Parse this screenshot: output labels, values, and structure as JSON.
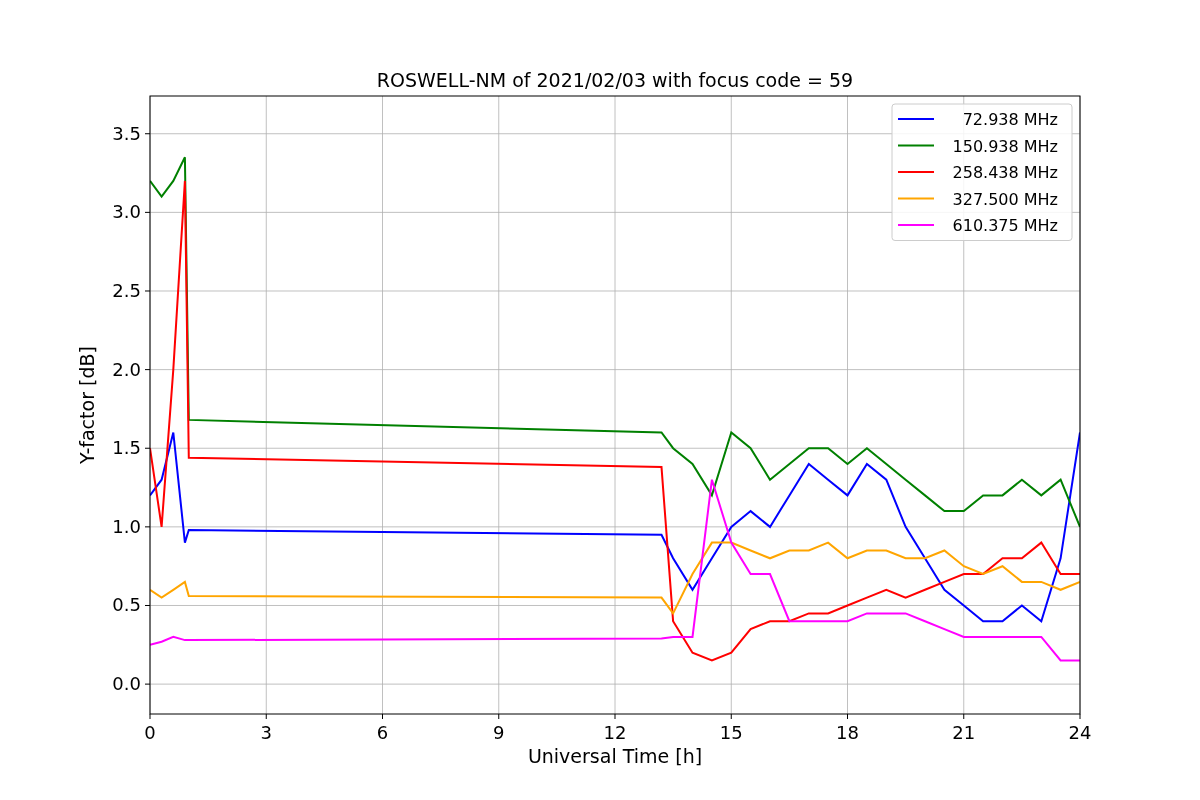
{
  "chart_data": {
    "type": "line",
    "title": "ROSWELL-NM of 2021/02/03 with focus code = 59",
    "xlabel": "Universal Time [h]",
    "ylabel": "Y-factor [dB]",
    "x": [
      0,
      0.3,
      0.6,
      0.9,
      1.0,
      13.2,
      13.5,
      14,
      14.5,
      15,
      15.5,
      16,
      16.5,
      17,
      17.5,
      18,
      18.5,
      19,
      19.5,
      20,
      20.5,
      21,
      21.5,
      22,
      22.5,
      23,
      23.5,
      24
    ],
    "series": [
      {
        "name": "72.938 MHz",
        "color": "#0000ff",
        "values": [
          1.2,
          1.3,
          1.6,
          0.9,
          0.98,
          0.95,
          0.8,
          0.6,
          0.8,
          1.0,
          1.1,
          1.0,
          1.2,
          1.4,
          1.3,
          1.2,
          1.4,
          1.3,
          1.0,
          0.8,
          0.6,
          0.5,
          0.4,
          0.4,
          0.5,
          0.4,
          0.8,
          1.6
        ]
      },
      {
        "name": "150.938 MHz",
        "color": "#008000",
        "values": [
          3.2,
          3.1,
          3.2,
          3.35,
          1.68,
          1.6,
          1.5,
          1.4,
          1.2,
          1.6,
          1.5,
          1.3,
          1.4,
          1.5,
          1.5,
          1.4,
          1.5,
          1.4,
          1.3,
          1.2,
          1.1,
          1.1,
          1.2,
          1.2,
          1.3,
          1.2,
          1.3,
          1.0
        ]
      },
      {
        "name": "258.438 MHz",
        "color": "#ff0000",
        "values": [
          1.5,
          1.0,
          2.0,
          3.2,
          1.44,
          1.38,
          0.4,
          0.2,
          0.15,
          0.2,
          0.35,
          0.4,
          0.4,
          0.45,
          0.45,
          0.5,
          0.55,
          0.6,
          0.55,
          0.6,
          0.65,
          0.7,
          0.7,
          0.8,
          0.8,
          0.9,
          0.7,
          0.7
        ]
      },
      {
        "name": "327.500 MHz",
        "color": "#ffa500",
        "values": [
          0.6,
          0.55,
          0.6,
          0.65,
          0.56,
          0.55,
          0.45,
          0.7,
          0.9,
          0.9,
          0.85,
          0.8,
          0.85,
          0.85,
          0.9,
          0.8,
          0.85,
          0.85,
          0.8,
          0.8,
          0.85,
          0.75,
          0.7,
          0.75,
          0.65,
          0.65,
          0.6,
          0.65
        ]
      },
      {
        "name": "610.375 MHz",
        "color": "#ff00ff",
        "values": [
          0.25,
          0.27,
          0.3,
          0.28,
          0.28,
          0.29,
          0.3,
          0.3,
          1.3,
          0.9,
          0.7,
          0.7,
          0.4,
          0.4,
          0.4,
          0.4,
          0.45,
          0.45,
          0.45,
          0.4,
          0.35,
          0.3,
          0.3,
          0.3,
          0.3,
          0.3,
          0.15,
          0.15
        ]
      }
    ],
    "grid": true,
    "legend": true,
    "xlim": [
      0,
      24
    ],
    "ylim": [
      -0.19,
      3.74
    ],
    "xticks": [
      0,
      3,
      6,
      9,
      12,
      15,
      18,
      21,
      24
    ],
    "yticks": [
      {
        "value": 0,
        "label": "0.0"
      },
      {
        "value": 0.5,
        "label": "0.5"
      },
      {
        "value": 1,
        "label": "1.0"
      },
      {
        "value": 1.5,
        "label": "1.5"
      },
      {
        "value": 2,
        "label": "2.0"
      },
      {
        "value": 2.5,
        "label": "2.5"
      },
      {
        "value": 3,
        "label": "3.0"
      },
      {
        "value": 3.5,
        "label": "3.5"
      }
    ]
  }
}
